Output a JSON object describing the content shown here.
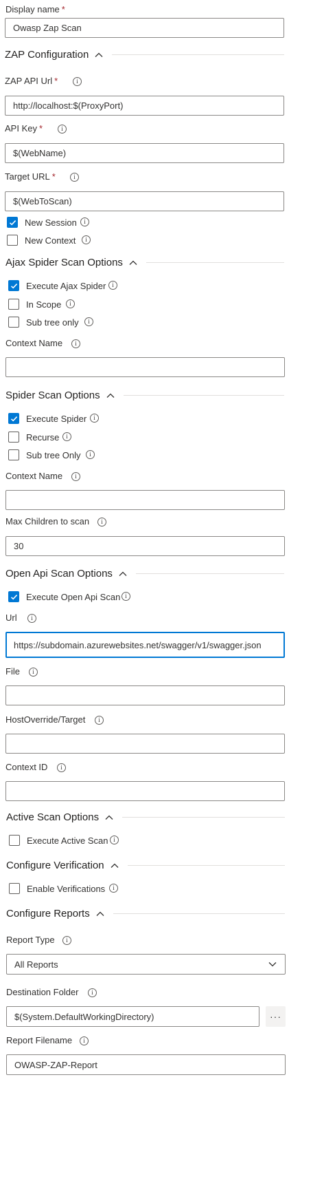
{
  "display_name": {
    "label": "Display name",
    "required": "*",
    "value": "Owasp Zap Scan"
  },
  "zap_config": {
    "title": "ZAP Configuration",
    "api_url": {
      "label": "ZAP API Url",
      "required": "*",
      "value": "http://localhost:$(ProxyPort)"
    },
    "api_key": {
      "label": "API Key",
      "required": "*",
      "value": "$(WebName)"
    },
    "target_url": {
      "label": "Target URL",
      "required": "*",
      "value": "$(WebToScan)"
    },
    "new_session": {
      "label": "New Session",
      "checked": true
    },
    "new_context": {
      "label": "New Context",
      "checked": false
    }
  },
  "ajax": {
    "title": "Ajax Spider Scan Options",
    "execute": {
      "label": "Execute Ajax Spider",
      "checked": true
    },
    "in_scope": {
      "label": "In Scope",
      "checked": false
    },
    "sub_tree": {
      "label": "Sub tree only",
      "checked": false
    },
    "context_name": {
      "label": "Context Name",
      "value": ""
    }
  },
  "spider": {
    "title": "Spider Scan Options",
    "execute": {
      "label": "Execute Spider",
      "checked": true
    },
    "recurse": {
      "label": "Recurse",
      "checked": false
    },
    "sub_tree": {
      "label": "Sub tree Only",
      "checked": false
    },
    "context_name": {
      "label": "Context Name",
      "value": ""
    },
    "max_children": {
      "label": "Max Children to scan",
      "value": "30"
    }
  },
  "openapi": {
    "title": "Open Api Scan Options",
    "execute": {
      "label": "Execute Open Api Scan",
      "checked": true
    },
    "url": {
      "label": "Url",
      "value": "https://subdomain.azurewebsites.net/swagger/v1/swagger.json"
    },
    "file": {
      "label": "File",
      "value": ""
    },
    "host_override": {
      "label": "HostOverride/Target",
      "value": ""
    },
    "context_id": {
      "label": "Context ID",
      "value": ""
    }
  },
  "active": {
    "title": "Active Scan Options",
    "execute": {
      "label": "Execute Active Scan",
      "checked": false
    }
  },
  "verification": {
    "title": "Configure Verification",
    "enable": {
      "label": "Enable Verifications",
      "checked": false
    }
  },
  "reports": {
    "title": "Configure Reports",
    "report_type": {
      "label": "Report Type",
      "value": "All Reports"
    },
    "dest_folder": {
      "label": "Destination Folder",
      "value": "$(System.DefaultWorkingDirectory)",
      "browse": "···"
    },
    "filename": {
      "label": "Report Filename",
      "value": "OWASP-ZAP-Report"
    }
  },
  "icons": {
    "info": "info-icon",
    "chevron_up": "chevron-up-icon",
    "chevron_down": "chevron-down-icon",
    "check": "checkmark-icon"
  },
  "colors": {
    "accent": "#0078d4",
    "required": "#a4262c",
    "border": "#8a8886"
  }
}
